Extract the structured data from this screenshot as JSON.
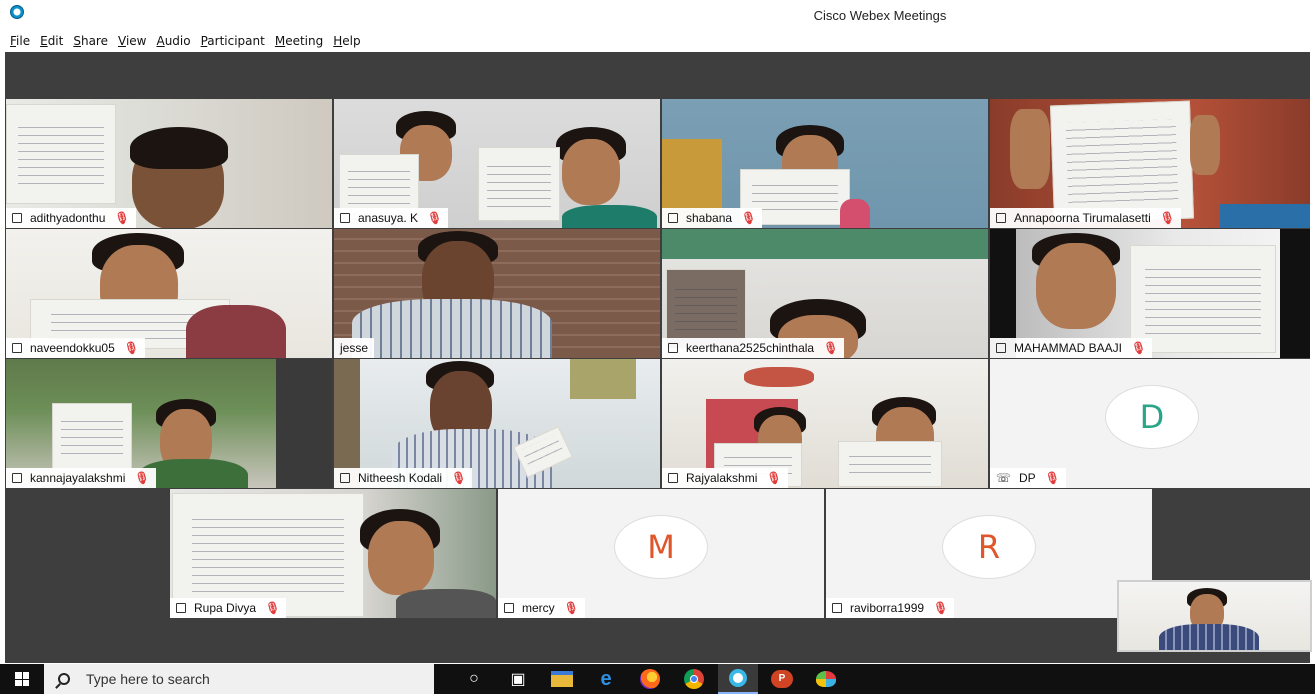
{
  "window": {
    "title": "Cisco Webex Meetings"
  },
  "menu": [
    "File",
    "Edit",
    "Share",
    "View",
    "Audio",
    "Participant",
    "Meeting",
    "Help"
  ],
  "participants": [
    {
      "name": "adithyadonthu"
    },
    {
      "name": "anasuya. K"
    },
    {
      "name": "shabana"
    },
    {
      "name": "Annapoorna Tirumalasetti"
    },
    {
      "name": "naveendokku05"
    },
    {
      "name": "jesse"
    },
    {
      "name": "keerthana2525chinthala"
    },
    {
      "name": "MAHAMMAD BAAJI"
    },
    {
      "name": "kannajayalakshmi"
    },
    {
      "name": "Nitheesh Kodali"
    },
    {
      "name": "Rajyalakshmi"
    },
    {
      "name": "DP",
      "initial": "D",
      "initial_color": "#2aa58a"
    },
    {
      "name": "Rupa Divya"
    },
    {
      "name": "mercy",
      "initial": "M",
      "initial_color": "#e0562b"
    },
    {
      "name": "raviborra1999",
      "initial": "R",
      "initial_color": "#e0562b"
    }
  ],
  "taskbar": {
    "search_placeholder": "Type here to search",
    "icons": [
      "cortana-icon",
      "task-view-icon",
      "file-explorer-icon",
      "edge-icon",
      "firefox-icon",
      "chrome-icon",
      "webex-icon",
      "powerpoint-icon",
      "paint-icon"
    ]
  },
  "colors": {
    "mute": "#e23b3b",
    "meeting_bg": "#3e3e3e",
    "taskbar_bg": "#101010"
  }
}
